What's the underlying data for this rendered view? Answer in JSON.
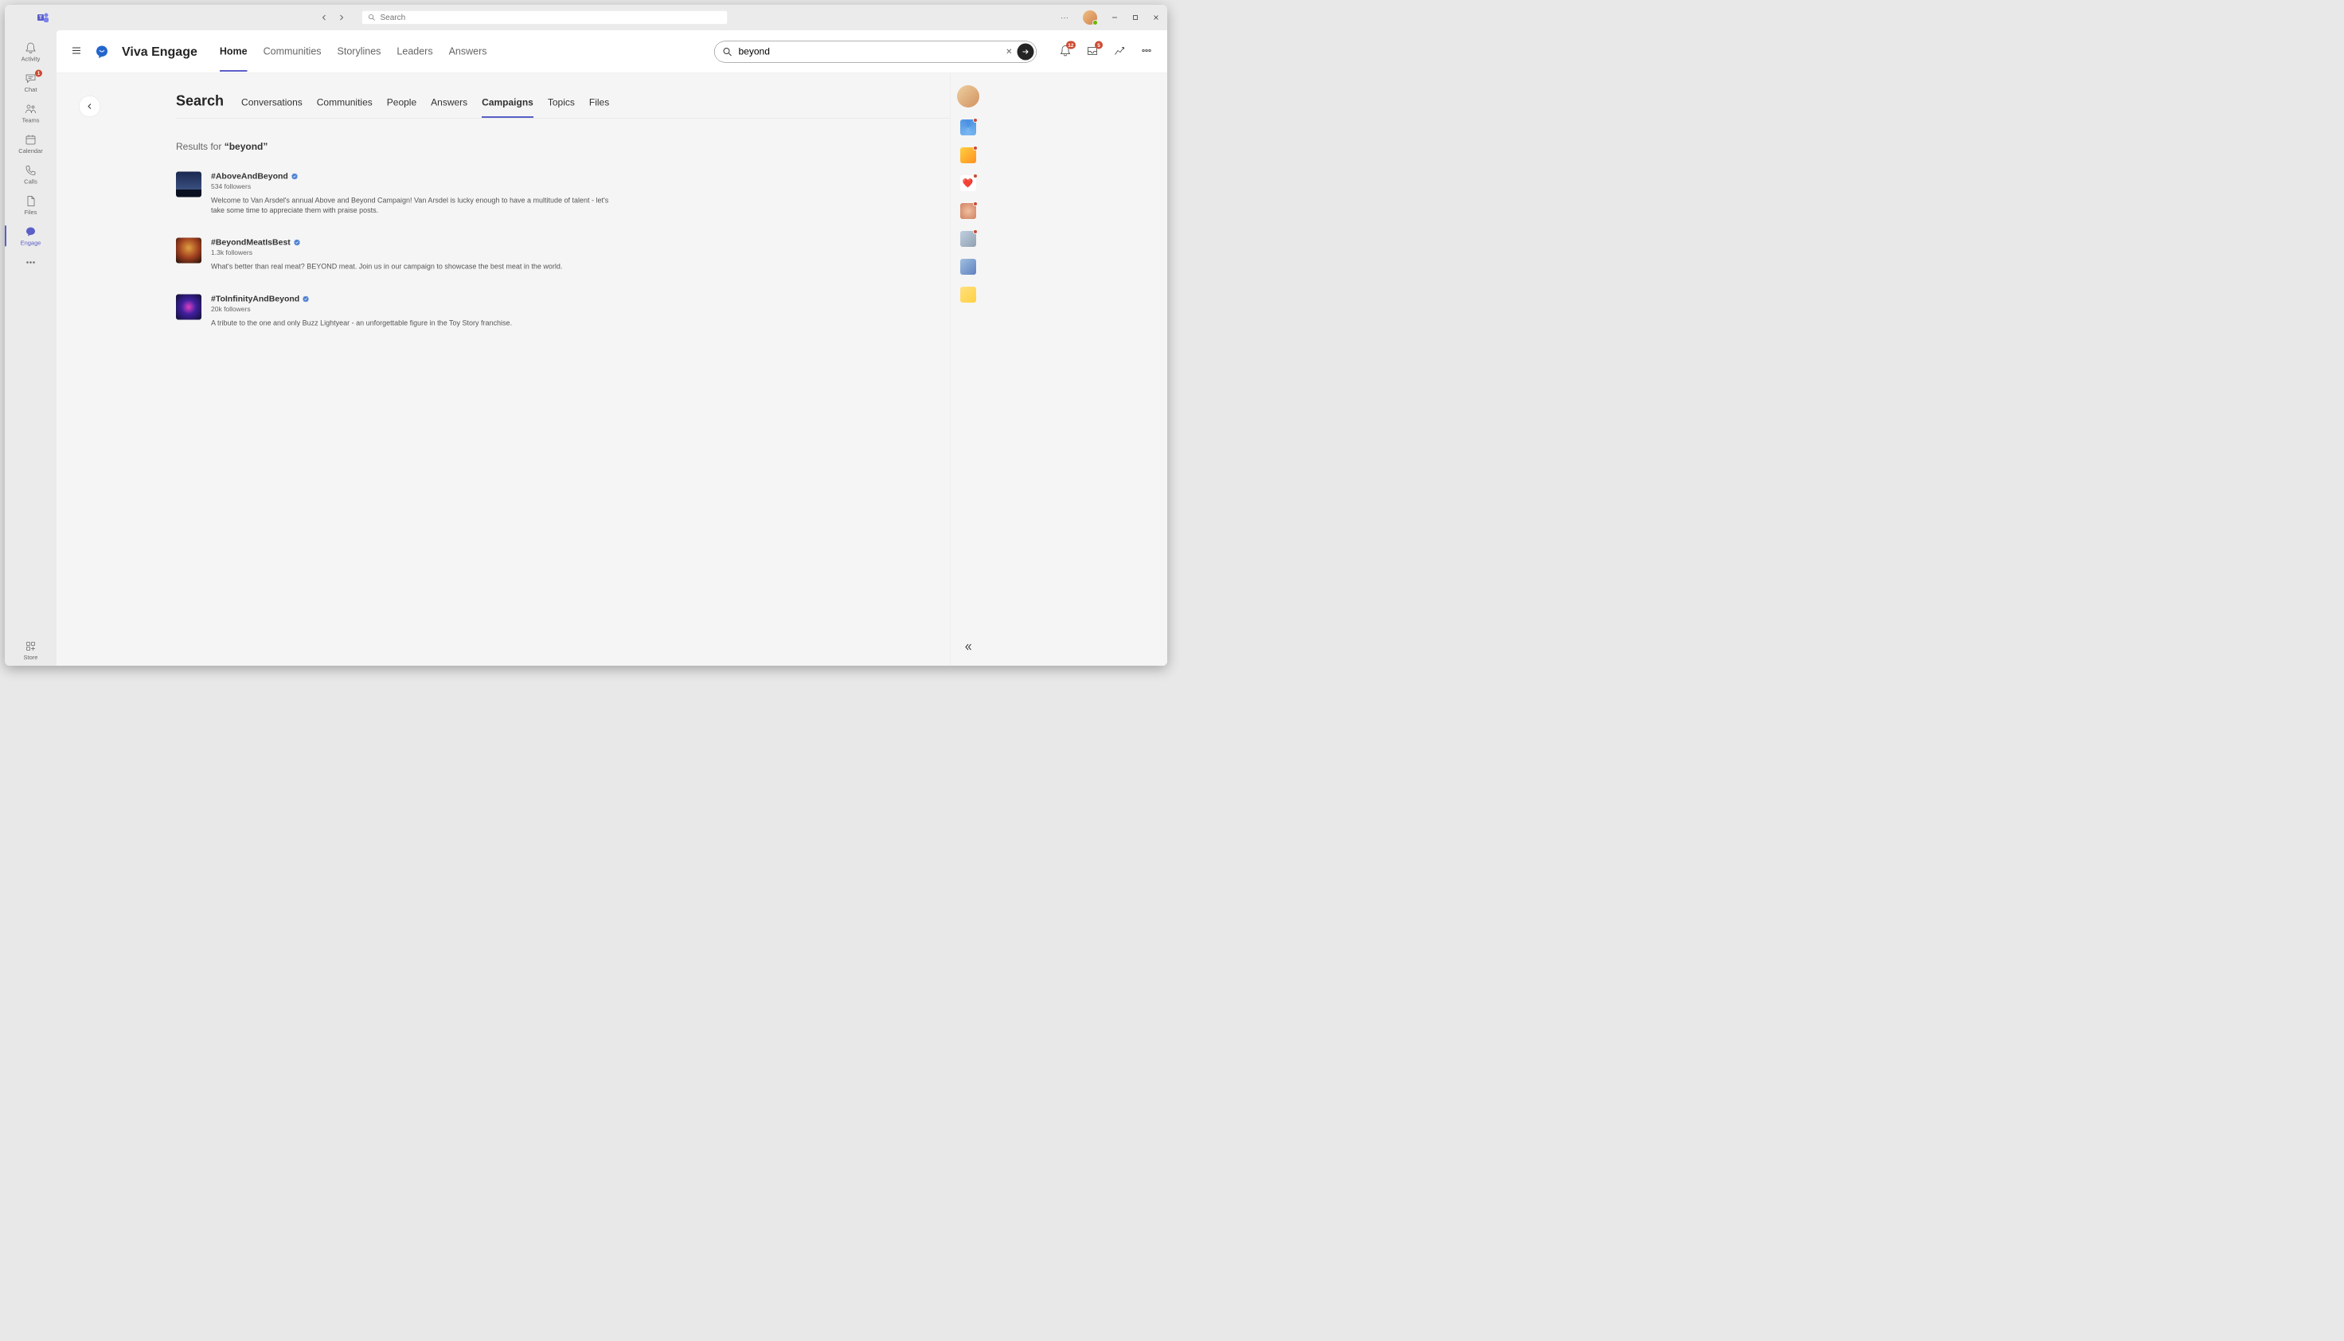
{
  "titlebar": {
    "search_placeholder": "Search"
  },
  "left_rail": {
    "items": [
      {
        "label": "Activity",
        "badge": null
      },
      {
        "label": "Chat",
        "badge": "1"
      },
      {
        "label": "Teams",
        "badge": null
      },
      {
        "label": "Calendar",
        "badge": null
      },
      {
        "label": "Calls",
        "badge": null
      },
      {
        "label": "Files",
        "badge": null
      },
      {
        "label": "Engage",
        "badge": null
      }
    ],
    "store_label": "Store"
  },
  "app_header": {
    "app_name": "Viva Engage",
    "tabs": [
      "Home",
      "Communities",
      "Storylines",
      "Leaders",
      "Answers"
    ],
    "active_tab": 0,
    "search_value": "beyond",
    "notif_badge": "12",
    "inbox_badge": "5"
  },
  "search_page": {
    "title": "Search",
    "tabs": [
      "Conversations",
      "Communities",
      "People",
      "Answers",
      "Campaigns",
      "Topics",
      "Files"
    ],
    "active_tab": 4,
    "results_prefix": "Results for ",
    "query_display": "“beyond”",
    "results": [
      {
        "title": "#AboveAndBeyond",
        "followers": "534 followers",
        "desc": "Welcome to Van Arsdel's annual Above and Beyond Campaign! Van Arsdel is lucky enough to have a multitude of talent - let's take some time to appreciate them with praise posts."
      },
      {
        "title": "#BeyondMeatIsBest",
        "followers": "1.3k followers",
        "desc": "What's better than real meat? BEYOND meat. Join us in our campaign to showcase the best meat in the world."
      },
      {
        "title": "#ToInfinityAndBeyond",
        "followers": "20k followers",
        "desc": "A tribute to the one and only Buzz Lightyear - an unforgettable figure in the Toy Story franchise."
      }
    ]
  }
}
